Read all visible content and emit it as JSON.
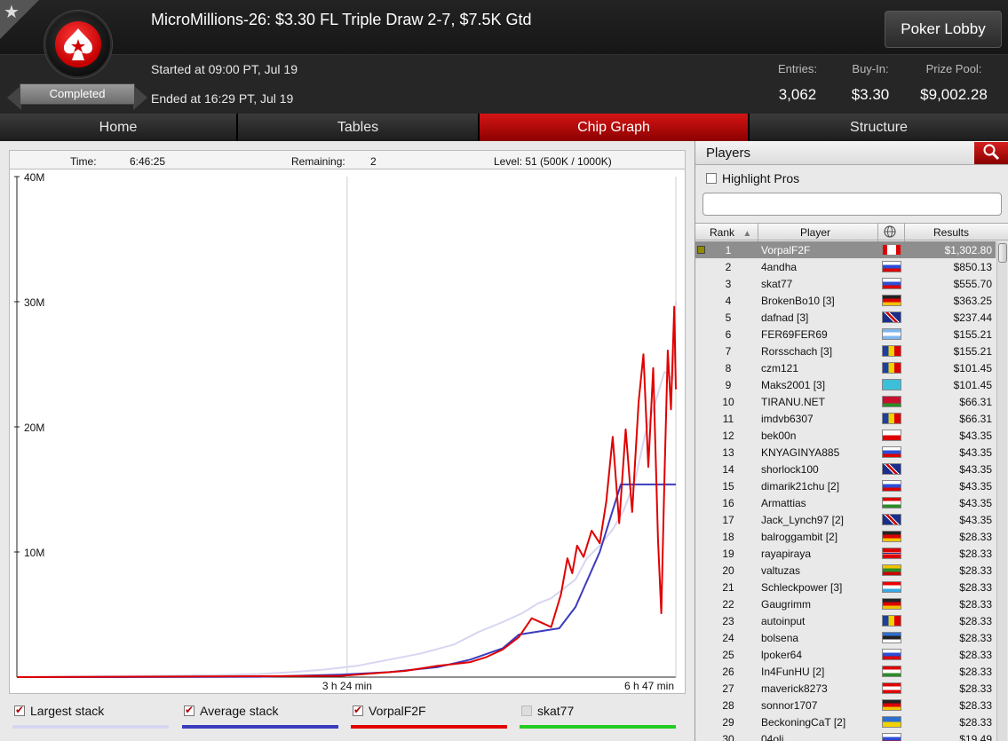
{
  "header": {
    "title": "MicroMillions-26: $3.30 FL Triple Draw 2-7, $7.5K Gtd",
    "status_badge": "Completed",
    "started": "Started at 09:00 PT, Jul 19",
    "ended": "Ended at 16:29 PT, Jul 19",
    "lobby_button": "Poker Lobby",
    "stats": [
      {
        "label": "Entries:",
        "value": "3,062"
      },
      {
        "label": "Buy-In:",
        "value": "$3.30"
      },
      {
        "label": "Prize Pool:",
        "value": "$9,002.28"
      }
    ],
    "icons": {
      "favorite": "star-icon",
      "logo": "pokerstars-logo-icon"
    }
  },
  "tabs": [
    {
      "label": "Home",
      "active": false
    },
    {
      "label": "Tables",
      "active": false
    },
    {
      "label": "Chip Graph",
      "active": true
    },
    {
      "label": "Structure",
      "active": false
    }
  ],
  "chart_info": {
    "time_label": "Time:",
    "time_value": "6:46:25",
    "remaining_label": "Remaining:",
    "remaining_value": "2",
    "level_text": "Level: 51 (500K / 1000K)"
  },
  "chart_data": {
    "type": "line",
    "title": "",
    "xlabel": "",
    "ylabel": "",
    "x_unit": "minutes",
    "xlim": [
      0,
      407
    ],
    "ylim": [
      0,
      40
    ],
    "y_unit": "M chips",
    "y_ticks": [
      {
        "value": 10,
        "label": "10M"
      },
      {
        "value": 20,
        "label": "20M"
      },
      {
        "value": 30,
        "label": "30M"
      },
      {
        "value": 40,
        "label": "40M"
      }
    ],
    "x_ticks": [
      {
        "value": 204,
        "label": "3 h 24 min"
      },
      {
        "value": 407,
        "label": "6 h 47 min"
      }
    ],
    "grid": false,
    "series": [
      {
        "name": "Largest stack",
        "color": "#d6d6f2",
        "x": [
          0,
          40,
          80,
          120,
          150,
          170,
          190,
          210,
          230,
          250,
          270,
          285,
          300,
          312,
          322,
          330,
          338,
          345,
          352,
          360,
          368,
          375,
          382,
          388,
          394,
          400,
          405,
          407
        ],
        "y": [
          0,
          0.05,
          0.1,
          0.15,
          0.25,
          0.4,
          0.6,
          0.9,
          1.4,
          1.9,
          2.6,
          3.6,
          4.4,
          5.1,
          5.9,
          6.3,
          7.1,
          7.8,
          9.5,
          10.5,
          11.8,
          13.4,
          15.8,
          19.4,
          21.8,
          24.4,
          23.8,
          30.0
        ]
      },
      {
        "name": "Average stack",
        "color": "#3b3bbf",
        "x": [
          0,
          100,
          150,
          200,
          230,
          260,
          280,
          300,
          310,
          320,
          335,
          345,
          360,
          373,
          380,
          390,
          400,
          405,
          407
        ],
        "y": [
          0,
          0.01,
          0.03,
          0.2,
          0.4,
          0.8,
          1.4,
          2.3,
          3.4,
          3.6,
          3.9,
          5.6,
          10.0,
          15.4,
          15.4,
          15.4,
          15.4,
          15.4,
          15.4
        ]
      },
      {
        "name": "VorpalF2F",
        "color": "#e00000",
        "x": [
          0,
          200,
          240,
          260,
          280,
          290,
          300,
          310,
          318,
          325,
          330,
          336,
          340,
          343,
          346,
          350,
          355,
          360,
          364,
          368,
          372,
          376,
          380,
          384,
          387,
          390,
          393,
          396,
          398,
          400,
          402,
          404,
          406,
          407
        ],
        "y": [
          0,
          0.1,
          0.5,
          0.9,
          1.2,
          1.6,
          2.2,
          3.2,
          4.7,
          4.3,
          4.0,
          6.6,
          9.5,
          8.3,
          10.5,
          9.6,
          11.7,
          10.7,
          14.0,
          19.2,
          12.3,
          19.8,
          13.2,
          22.0,
          25.8,
          16.8,
          24.7,
          11.0,
          5.1,
          16.0,
          26.1,
          21.4,
          29.6,
          23.0
        ]
      },
      {
        "name": "skat77",
        "color": "#22cc22",
        "visible": false,
        "x": [],
        "y": []
      }
    ]
  },
  "legend": [
    {
      "label": "Largest stack",
      "checked": true,
      "color": "#d6d6f2"
    },
    {
      "label": "Average stack",
      "checked": true,
      "color": "#3b3bbf"
    },
    {
      "label": "VorpalF2F",
      "checked": true,
      "color": "#e00000"
    },
    {
      "label": "skat77",
      "checked": false,
      "color": "#22cc22"
    }
  ],
  "players_panel": {
    "title": "Players",
    "highlight_label": "Highlight Pros",
    "filter_placeholder": "",
    "columns": {
      "rank": "Rank",
      "player": "Player",
      "results": "Results"
    },
    "rows": [
      {
        "rank": "1",
        "player": "VorpalF2F",
        "flag": "canada",
        "result": "$1,302.80"
      },
      {
        "rank": "2",
        "player": "4andha",
        "flag": "russia",
        "result": "$850.13"
      },
      {
        "rank": "3",
        "player": "skat77",
        "flag": "russia",
        "result": "$555.70"
      },
      {
        "rank": "4",
        "player": "BrokenBo10 [3]",
        "flag": "germany",
        "result": "$363.25"
      },
      {
        "rank": "5",
        "player": "dafnad [3]",
        "flag": "uk",
        "result": "$237.44"
      },
      {
        "rank": "6",
        "player": "FER69FER69",
        "flag": "argentina",
        "result": "$155.21"
      },
      {
        "rank": "7",
        "player": "Rorsschach [3]",
        "flag": "romania",
        "result": "$155.21"
      },
      {
        "rank": "8",
        "player": "czm121",
        "flag": "romania",
        "result": "$101.45"
      },
      {
        "rank": "9",
        "player": "Maks2001 [3]",
        "flag": "kazakhstan",
        "result": "$101.45"
      },
      {
        "rank": "10",
        "player": "TIRANU.NET",
        "flag": "belarus",
        "result": "$66.31"
      },
      {
        "rank": "11",
        "player": "imdvb6307",
        "flag": "romania",
        "result": "$66.31"
      },
      {
        "rank": "12",
        "player": "bek00n",
        "flag": "czech",
        "result": "$43.35"
      },
      {
        "rank": "13",
        "player": "KNYAGINYA885",
        "flag": "russia",
        "result": "$43.35"
      },
      {
        "rank": "14",
        "player": "shorlock100",
        "flag": "uk",
        "result": "$43.35"
      },
      {
        "rank": "15",
        "player": "dimarik21chu [2]",
        "flag": "russia",
        "result": "$43.35"
      },
      {
        "rank": "16",
        "player": "Armattias",
        "flag": "hungary",
        "result": "$43.35"
      },
      {
        "rank": "17",
        "player": "Jack_Lynch97 [2]",
        "flag": "uk",
        "result": "$43.35"
      },
      {
        "rank": "18",
        "player": "balroggambit [2]",
        "flag": "germany",
        "result": "$28.33"
      },
      {
        "rank": "19",
        "player": "rayapiraya",
        "flag": "norway",
        "result": "$28.33"
      },
      {
        "rank": "20",
        "player": "valtuzas",
        "flag": "lithuania",
        "result": "$28.33"
      },
      {
        "rank": "21",
        "player": "Schleckpower [3]",
        "flag": "luxembourg",
        "result": "$28.33"
      },
      {
        "rank": "22",
        "player": "Gaugrimm",
        "flag": "germany",
        "result": "$28.33"
      },
      {
        "rank": "23",
        "player": "autoinput",
        "flag": "romania",
        "result": "$28.33"
      },
      {
        "rank": "24",
        "player": "bolsena",
        "flag": "estonia",
        "result": "$28.33"
      },
      {
        "rank": "25",
        "player": "lpoker64",
        "flag": "russia",
        "result": "$28.33"
      },
      {
        "rank": "26",
        "player": "In4FunHU [2]",
        "flag": "hungary",
        "result": "$28.33"
      },
      {
        "rank": "27",
        "player": "maverick8273",
        "flag": "austria",
        "result": "$28.33"
      },
      {
        "rank": "28",
        "player": "sonnor1707",
        "flag": "germany",
        "result": "$28.33"
      },
      {
        "rank": "29",
        "player": "BeckoningCaT [2]",
        "flag": "ukraine",
        "result": "$28.33"
      },
      {
        "rank": "30",
        "player": "04oli",
        "flag": "russia",
        "result": "$19.49"
      }
    ]
  }
}
